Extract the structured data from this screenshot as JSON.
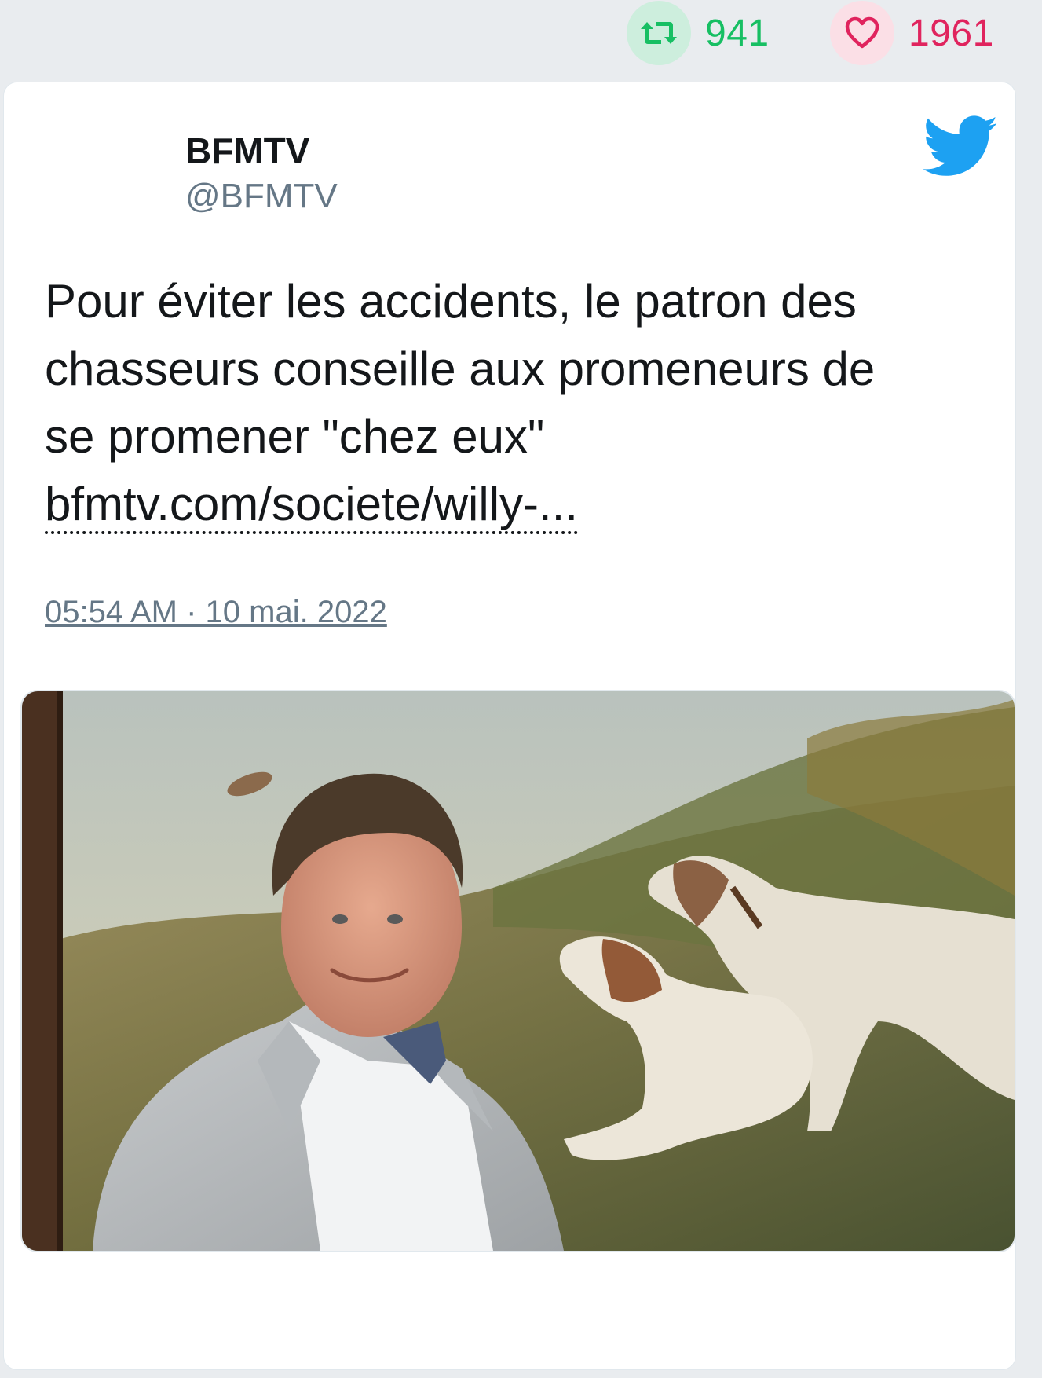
{
  "top_stats": {
    "retweet_icon": "retweet-icon",
    "retweet_count": "941",
    "like_icon": "heart-icon",
    "like_count": "1961"
  },
  "tweet": {
    "author_name": "BFMTV",
    "author_handle": "@BFMTV",
    "platform_icon": "twitter-bird-icon",
    "text_lines": "Pour éviter les accidents, le patron des\nchasseurs conseille aux promeneurs de\nse promener \"chez eux\"",
    "link_text": "bfmtv.com/societe/willy-...",
    "timestamp": "05:54 AM · 10 mai. 2022",
    "actions": {
      "reply_icon": "reply-icon",
      "retweet_icon": "retweet-icon",
      "like_icon": "heart-icon"
    },
    "media": {
      "type": "photo",
      "description_icon": "photo-man-with-hunting-dogs-painting"
    }
  },
  "colors": {
    "background": "#e9ecef",
    "retweet_green": "#17bf63",
    "like_red": "#e0245e",
    "twitter_blue": "#1da1f2",
    "muted_text": "#657786"
  }
}
